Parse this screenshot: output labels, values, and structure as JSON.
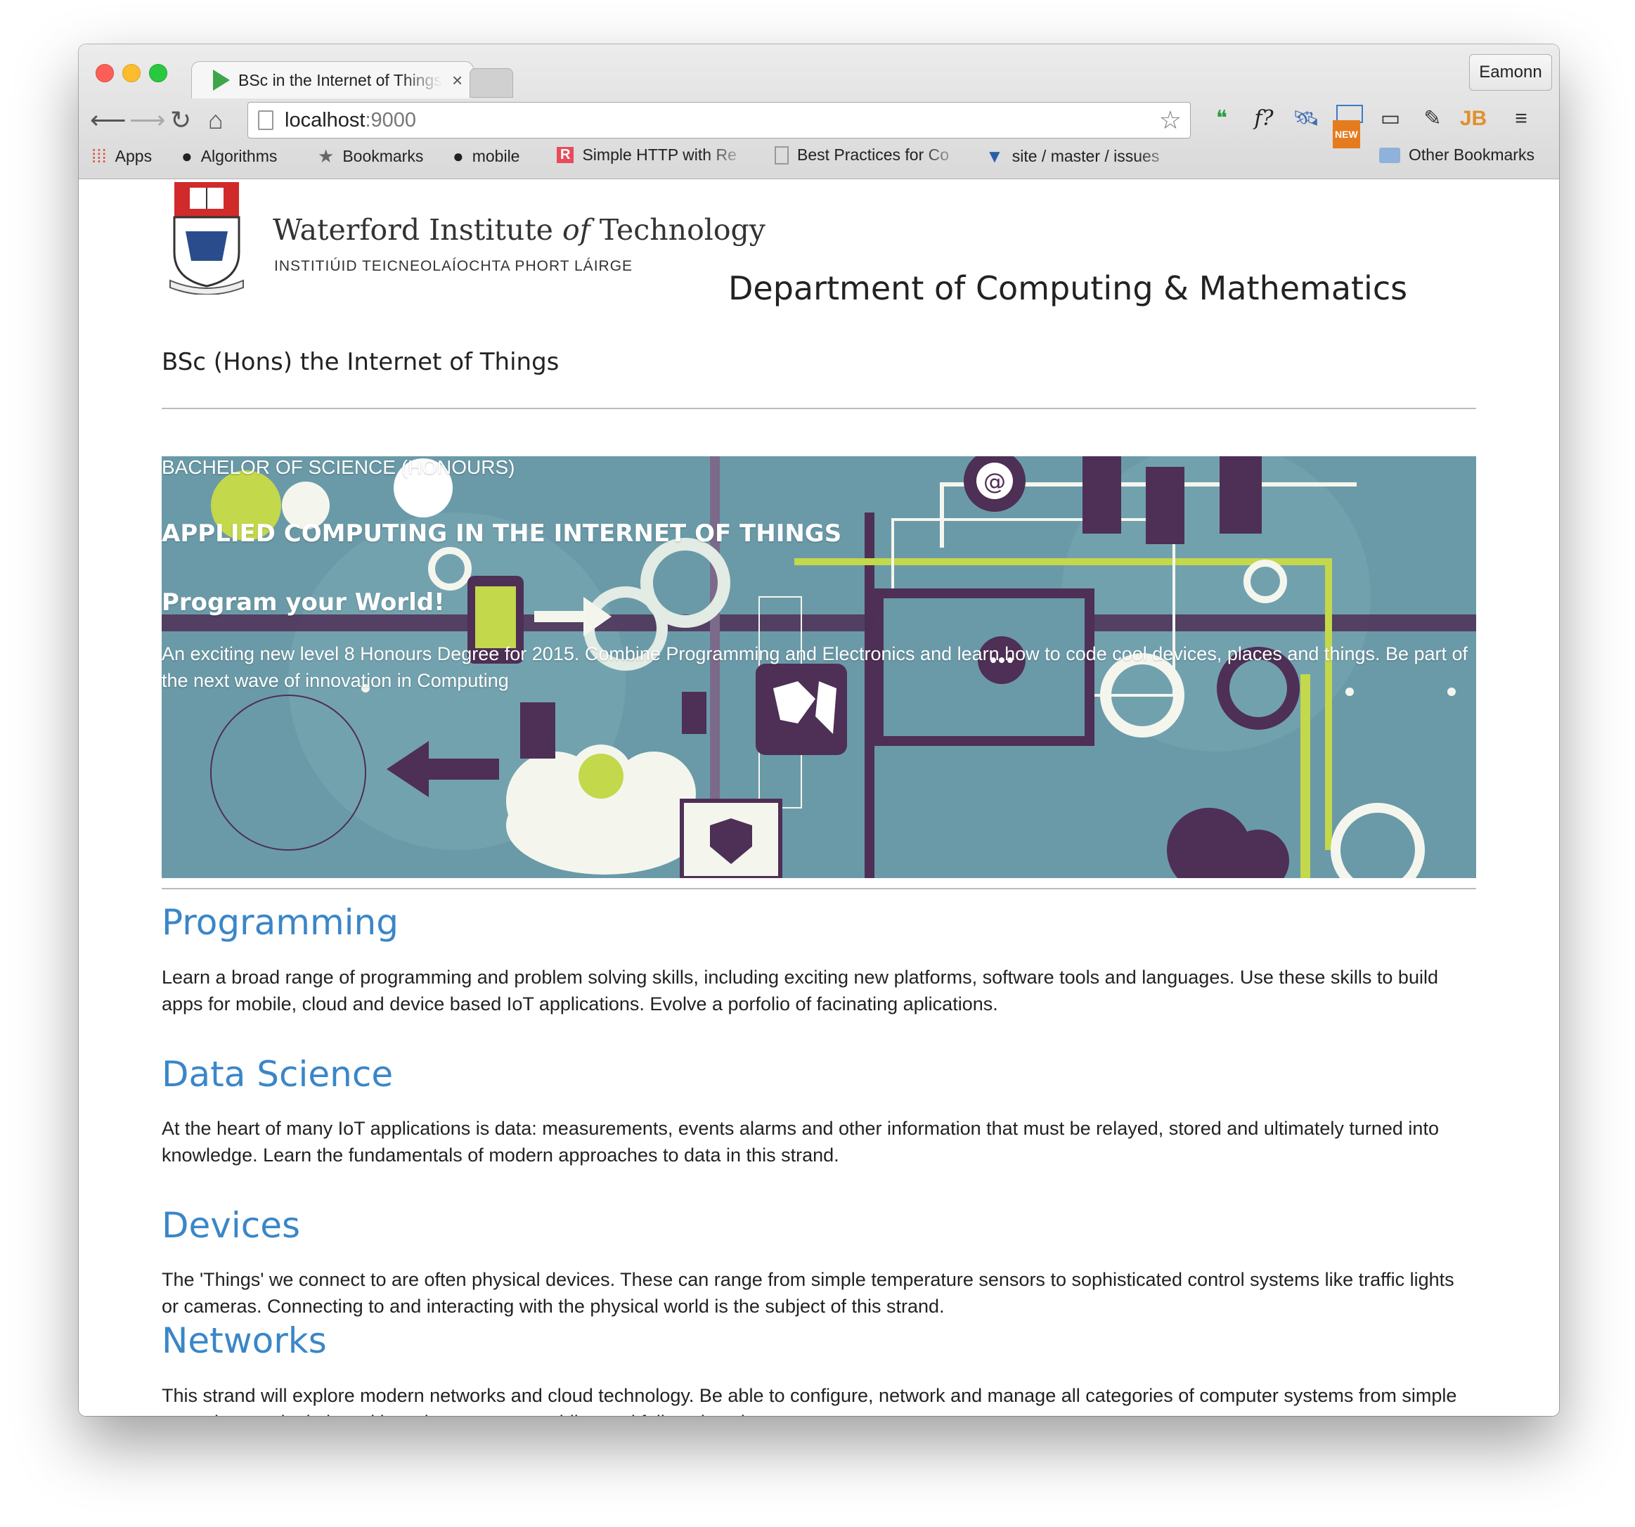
{
  "browser": {
    "tab_title": "BSc in the Internet of Things",
    "tab_close": "×",
    "profile_name": "Eamonn",
    "url_host": "localhost",
    "url_port": ":9000",
    "bookmarks": [
      {
        "label": "Apps",
        "icon": "apps-grid-icon"
      },
      {
        "label": "Algorithms",
        "icon": "github-icon"
      },
      {
        "label": "Bookmarks",
        "icon": "star-icon"
      },
      {
        "label": "mobile",
        "icon": "github-icon"
      },
      {
        "label": "Simple HTTP with Re",
        "icon": "r-logo-icon"
      },
      {
        "label": "Best Practices for Co",
        "icon": "page-icon"
      },
      {
        "label": "site / master / issues",
        "icon": "bitbucket-icon"
      },
      {
        "label": "Other Bookmarks",
        "icon": "folder-icon"
      }
    ],
    "extensions": [
      "hangouts-icon",
      "font-finder-icon",
      "satellite-icon",
      "new-window-icon",
      "cast-icon",
      "eyedropper-icon",
      "jetbrains-icon",
      "menu-icon"
    ],
    "ext_new_badge": "NEW",
    "ext_font_label": "f?",
    "ext_jb_label": "JB"
  },
  "header": {
    "logo_title_pre": "Waterford Institute ",
    "logo_title_of": "of",
    "logo_title_post": " Technology",
    "logo_subtitle": "INSTITIÚID TEICNEOLAÍOCHTA PHORT LÁIRGE",
    "department": "Department of Computing & Mathematics"
  },
  "course_title": "BSc (Hons) the Internet of Things",
  "banner": {
    "line1": "BACHELOR OF SCIENCE (HONOURS)",
    "line2": "APPLIED COMPUTING IN THE INTERNET OF THINGS",
    "line3": "Program your World!",
    "line4": "An exciting new level 8 Honours Degree for 2015. Combine Programming and Electronics and learn how to code cool devices, places and things. Be part of the next wave of innovation in Computing",
    "colors": {
      "bg": "#6a9aa8",
      "purple": "#4e2f55",
      "lime": "#c3d84a",
      "white": "#f4f6ee"
    }
  },
  "sections": [
    {
      "heading": "Programming",
      "text": "Learn a broad range of programming and problem solving skills, including exciting new platforms, software tools and languages. Use these skills to build apps for mobile, cloud and device based IoT applications. Evolve a porfolio of facinating aplications."
    },
    {
      "heading": "Data Science",
      "text": "At the heart of many IoT applications is data: measurements, events alarms and other information that must be relayed, stored and ultimately turned into knowledge. Learn the fundamentals of modern approaches to data in this strand."
    },
    {
      "heading": "Devices",
      "text": "The 'Things' we connect to are often physical devices. These can range from simple temperature sensors to sophisticated control systems like traffic lights or cameras. Connecting to and interacting with the physical world is the subject of this strand."
    },
    {
      "heading": "Networks",
      "text": "This strand will explore modern networks and cloud technology. Be able to configure, network and manage all categories of computer systems from simple controlers to single board board computers, mobiles and full workstations."
    }
  ],
  "accent_color": "#3a86c8"
}
